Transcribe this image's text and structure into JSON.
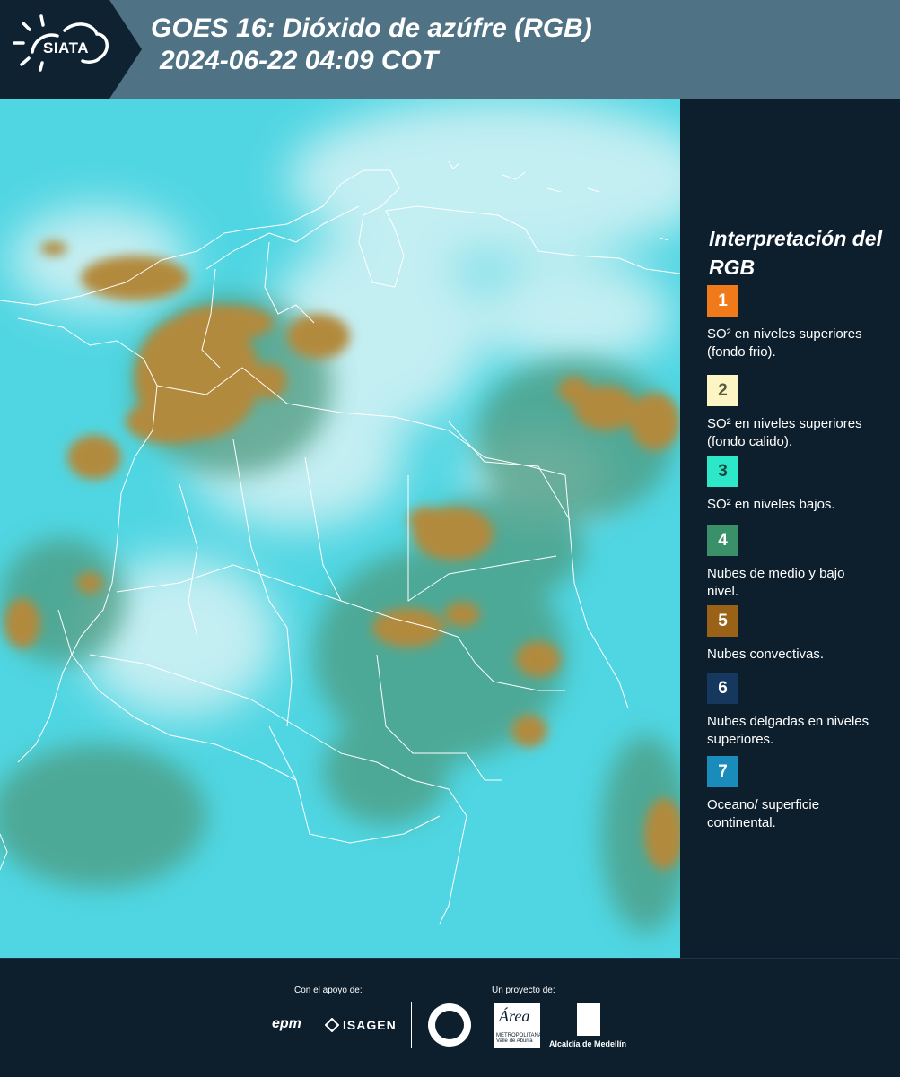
{
  "header": {
    "logo_text": "SIATA",
    "title_line1": "GOES 16: Dióxido de azúfre (RGB)",
    "title_line2": "2024-06-22 04:09 COT"
  },
  "legend": {
    "title": "Interpretación del RGB",
    "items": [
      {
        "number": "1",
        "label": "SO² en niveles superiores (fondo frio).",
        "color": "#f07a1a",
        "num_color": "#ffffff"
      },
      {
        "number": "2",
        "label": "SO² en niveles superiores (fondo calido).",
        "color": "#fdf5c4",
        "num_color": "#5a5a40"
      },
      {
        "number": "3",
        "label": "SO² en niveles bajos.",
        "color": "#2de8c8",
        "num_color": "#1a4a44"
      },
      {
        "number": "4",
        "label": "Nubes de medio y bajo nivel.",
        "color": "#3a9068",
        "num_color": "#ffffff"
      },
      {
        "number": "5",
        "label": "Nubes convectivas.",
        "color": "#9a6216",
        "num_color": "#ffffff"
      },
      {
        "number": "6",
        "label": "Nubes delgadas en niveles superiores.",
        "color": "#16375e",
        "num_color": "#ffffff"
      },
      {
        "number": "7",
        "label": "Oceano/ superficie continental.",
        "color": "#1a8cbc",
        "num_color": "#ffffff"
      }
    ]
  },
  "footer": {
    "support_label": "Con el apoyo de:",
    "project_label": "Un proyecto de:",
    "sponsor1": "epm",
    "sponsor2": "ISAGEN",
    "area_title": "Área",
    "area_subtitle": "METROPOLITANA Valle de Aburrá",
    "alcaldia": "Alcaldía de Medellín"
  },
  "map_colors": {
    "surface": "#4fd6e2",
    "convective": "#b28a3c",
    "mid_low": "#4e9a7e",
    "upper_thin": "#d6f2f4",
    "borders": "#ffffff"
  }
}
